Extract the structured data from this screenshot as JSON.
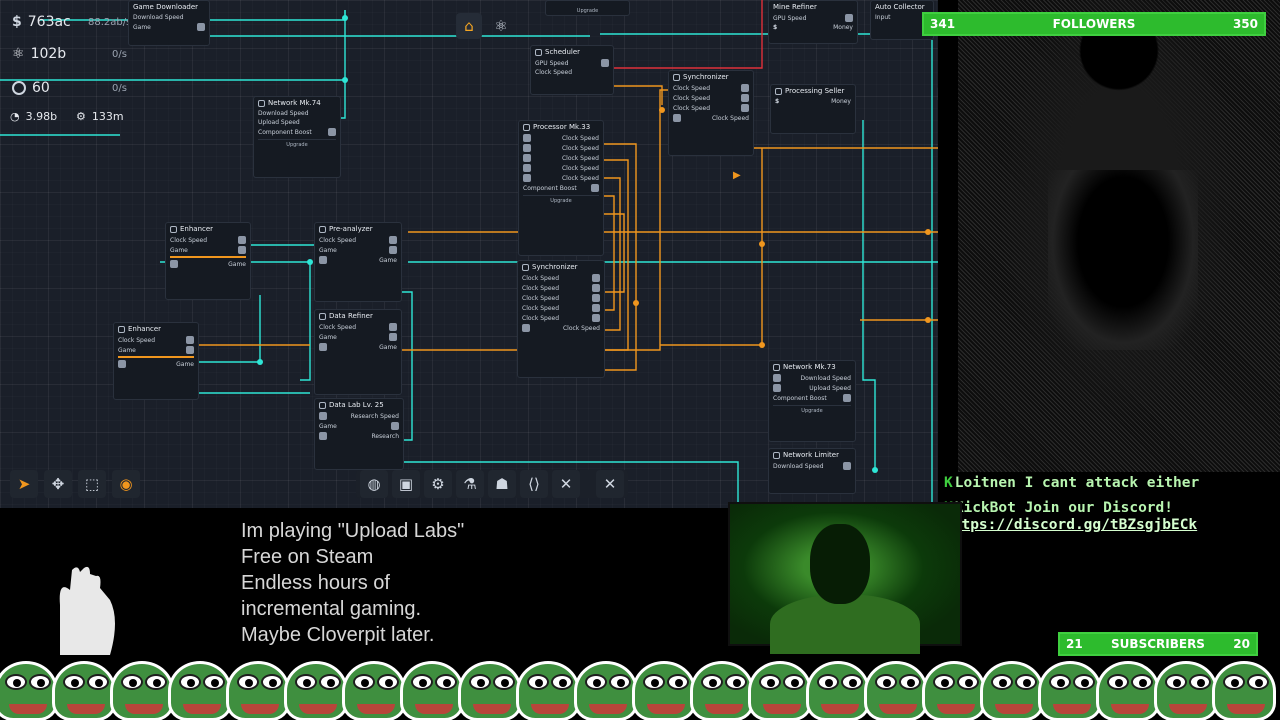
{
  "resources": [
    {
      "icon": "dollar-icon",
      "value": "763ac",
      "rate": "88.2ab/s"
    },
    {
      "icon": "atom-icon",
      "value": "102b",
      "rate": "0/s"
    },
    {
      "icon": "ring-icon",
      "value": "60",
      "rate": "0/s"
    }
  ],
  "stats": [
    {
      "icon": "pie-icon",
      "value": "3.98b"
    },
    {
      "icon": "gear-icon",
      "value": "133m"
    }
  ],
  "nodes": {
    "network_74": {
      "title": "Network Mk.74",
      "rows": [
        "Download Speed",
        "Upload Speed",
        "Component Boost"
      ],
      "foot": "Upgrade"
    },
    "scheduler": {
      "title": "Scheduler",
      "rows": [
        "GPU Speed",
        "Clock Speed"
      ]
    },
    "processor": {
      "title": "Processor Mk.33",
      "rows": [
        "Clock Speed",
        "Clock Speed",
        "Clock Speed",
        "Clock Speed",
        "Clock Speed",
        "Component Boost"
      ],
      "foot": "Upgrade"
    },
    "synchronizer_top": {
      "title": "Synchronizer",
      "rows": [
        "Clock Speed",
        "Clock Speed",
        "Clock Speed",
        "Clock Speed"
      ]
    },
    "processing_seller": {
      "title": "Processing Seller",
      "rows": [
        "Money"
      ]
    },
    "synchronizer": {
      "title": "Synchronizer",
      "rows": [
        "Clock Speed",
        "Clock Speed",
        "Clock Speed",
        "Clock Speed",
        "Clock Speed",
        "Clock Speed"
      ]
    },
    "enhancer_1": {
      "title": "Enhancer",
      "rows": [
        "Clock Speed",
        "Game",
        "Game"
      ]
    },
    "enhancer_2": {
      "title": "Enhancer",
      "rows": [
        "Clock Speed",
        "Game",
        "Game"
      ]
    },
    "pre_analyzer": {
      "title": "Pre-analyzer",
      "rows": [
        "Clock Speed",
        "Game",
        "Game"
      ]
    },
    "data_refiner": {
      "title": "Data Refiner",
      "rows": [
        "Clock Speed",
        "Game",
        "Game"
      ]
    },
    "data_lab": {
      "title": "Data Lab Lv. 25",
      "rows": [
        "Research Speed",
        "Game",
        "Research"
      ]
    },
    "network_73": {
      "title": "Network Mk.73",
      "rows": [
        "Download Speed",
        "Upload Speed",
        "Component Boost"
      ],
      "foot": "Upgrade"
    },
    "network_limiter": {
      "title": "Network Limiter",
      "rows": [
        "Download Speed"
      ]
    },
    "game_downloader": {
      "title": "Game Downloader",
      "rows": [
        "Download Speed",
        "Game"
      ]
    },
    "mine_refiner": {
      "title": "Mine Refiner",
      "rows": [
        "GPU Speed",
        "Money"
      ]
    },
    "auto_collector": {
      "title": "Auto Collector",
      "rows": [
        "Input"
      ]
    },
    "upgrade_top": {
      "title": "Upgrade"
    }
  },
  "overlay": {
    "followers": {
      "current": "341",
      "label": "FOLLOWERS",
      "goal": "350"
    },
    "subscribers": {
      "current": "21",
      "label": "SUBSCRIBERS",
      "goal": "20"
    },
    "chat": [
      {
        "user": "Loitnen",
        "message": "I cant attack either"
      },
      {
        "user": "KickBot",
        "message": "Join our Discord!",
        "link": "https://discord.gg/tBZsgjbECk"
      }
    ],
    "caption": [
      "Im playing \"Upload Labs\"",
      "Free on Steam",
      "Endless hours of",
      "incremental gaming.",
      "Maybe Cloverpit later."
    ]
  },
  "colors": {
    "wire_cyan": "#2ee6d6",
    "wire_orange": "#f0961e",
    "wire_red": "#e0303a",
    "accent_green": "#3fcf3f"
  }
}
